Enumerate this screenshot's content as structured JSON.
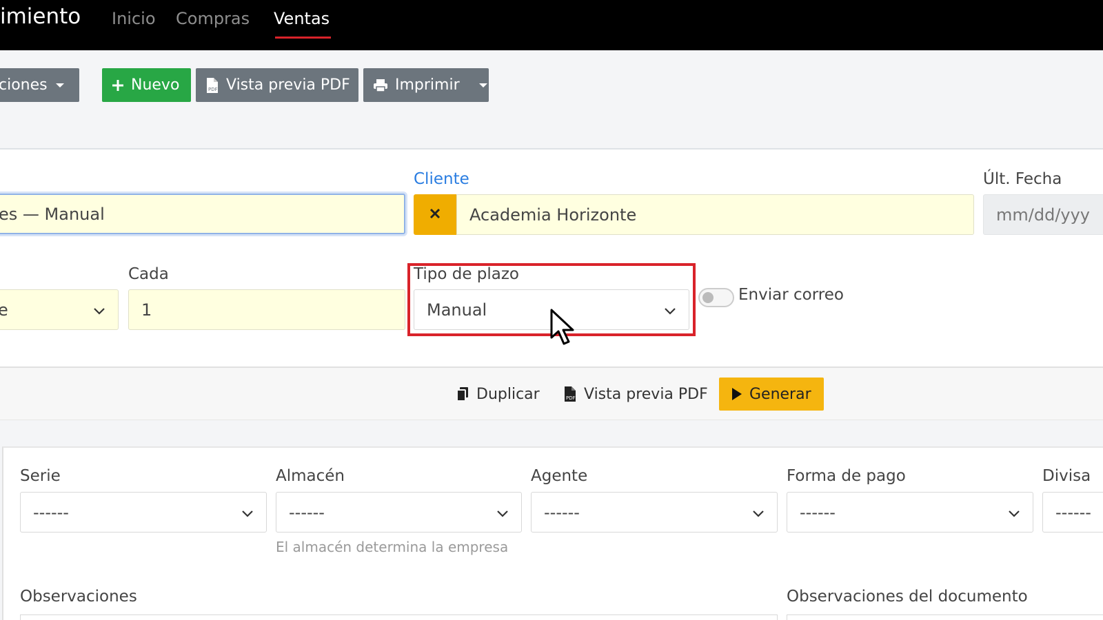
{
  "nav": {
    "brand": "imiento",
    "links": [
      "Inicio",
      "Compras",
      "Ventas"
    ]
  },
  "toolbar": {
    "options_label": "ciones",
    "new_label": "Nuevo",
    "pdf_label": "Vista previa PDF",
    "print_label": "Imprimir"
  },
  "form": {
    "name_value": "es — Manual",
    "cliente_label": "Cliente",
    "cliente_value": "Academia Horizonte",
    "ult_fecha_label": "Últ. Fecha",
    "ult_fecha_placeholder": "mm/dd/yyy",
    "freq_value": "e",
    "cada_label": "Cada",
    "cada_value": "1",
    "tipo_plazo_label": "Tipo de plazo",
    "tipo_plazo_value": "Manual",
    "enviar_correo_label": "Enviar correo"
  },
  "actions": {
    "duplicar": "Duplicar",
    "pdf": "Vista previa PDF",
    "generar": "Generar"
  },
  "details": {
    "serie_label": "Serie",
    "serie_value": "------",
    "almacen_label": "Almacén",
    "almacen_value": "------",
    "almacen_hint": "El almacén determina la empresa",
    "agente_label": "Agente",
    "agente_value": "------",
    "forma_pago_label": "Forma de pago",
    "forma_pago_value": "------",
    "divisa_label": "Divisa",
    "divisa_value": "------",
    "observaciones_label": "Observaciones",
    "observaciones_doc_label": "Observaciones del documento"
  },
  "colors": {
    "nav_bg": "#000000",
    "active_underline": "#d9232a",
    "btn_gray": "#6c757d",
    "btn_green": "#28a745",
    "clear_btn": "#f0ad00",
    "generar_btn": "#f5b50f",
    "highlight": "#d9232a",
    "field_yellow": "#ffffe0",
    "link_blue": "#2a7de1"
  }
}
